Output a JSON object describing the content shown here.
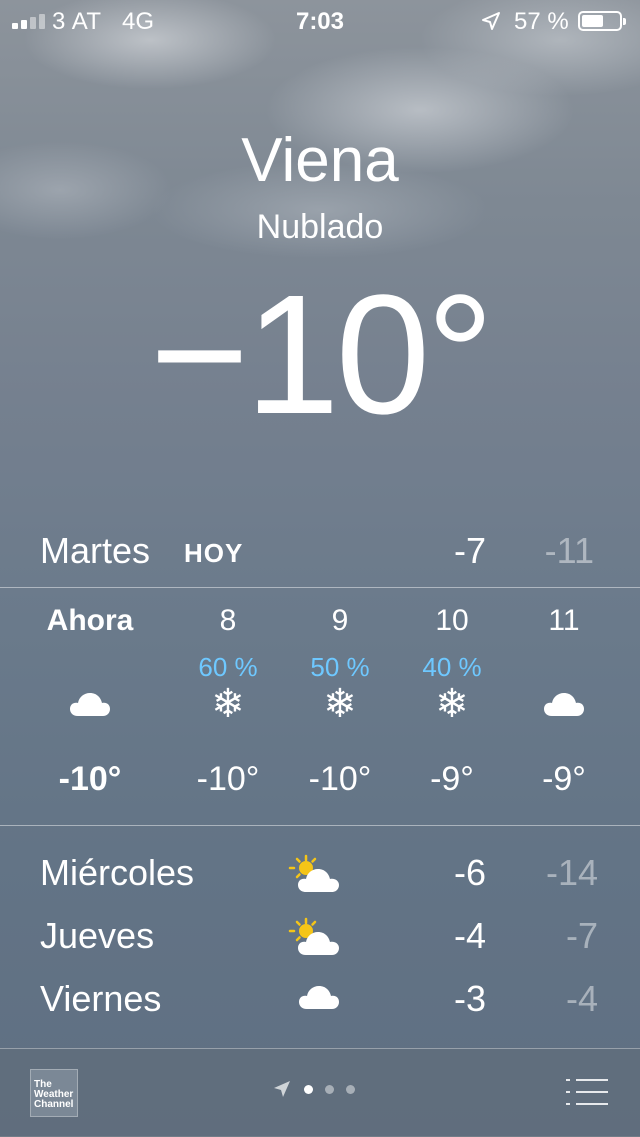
{
  "status_bar": {
    "carrier": "3 AT",
    "network": "4G",
    "time": "7:03",
    "battery": "57 %",
    "battery_level": 0.57,
    "signal_bars": 2
  },
  "location": {
    "city": "Viena",
    "condition": "Nublado",
    "temperature": "−10°"
  },
  "today": {
    "day": "Martes",
    "tag": "HOY",
    "high": "-7",
    "low": "-11"
  },
  "hourly": [
    {
      "label": "Ahora",
      "pop": "",
      "icon": "cloud-icon",
      "temp": "-10°"
    },
    {
      "label": "8",
      "pop": "60 %",
      "icon": "snowflake-icon",
      "temp": "-10°"
    },
    {
      "label": "9",
      "pop": "50 %",
      "icon": "snowflake-icon",
      "temp": "-10°"
    },
    {
      "label": "10",
      "pop": "40 %",
      "icon": "snowflake-icon",
      "temp": "-9°"
    },
    {
      "label": "11",
      "pop": "",
      "icon": "cloud-icon",
      "temp": "-9°"
    }
  ],
  "daily": [
    {
      "day": "Miércoles",
      "icon": "partly-sunny-icon",
      "high": "-6",
      "low": "-14"
    },
    {
      "day": "Jueves",
      "icon": "partly-sunny-icon",
      "high": "-4",
      "low": "-7"
    },
    {
      "day": "Viernes",
      "icon": "cloud-icon",
      "high": "-3",
      "low": "-4"
    }
  ],
  "toolbar": {
    "logo_text": "The Weather Channel",
    "page_count": 3,
    "active_page": 1
  },
  "colors": {
    "pop_blue": "#6ec8ff",
    "sun_yellow": "#f5c518"
  }
}
